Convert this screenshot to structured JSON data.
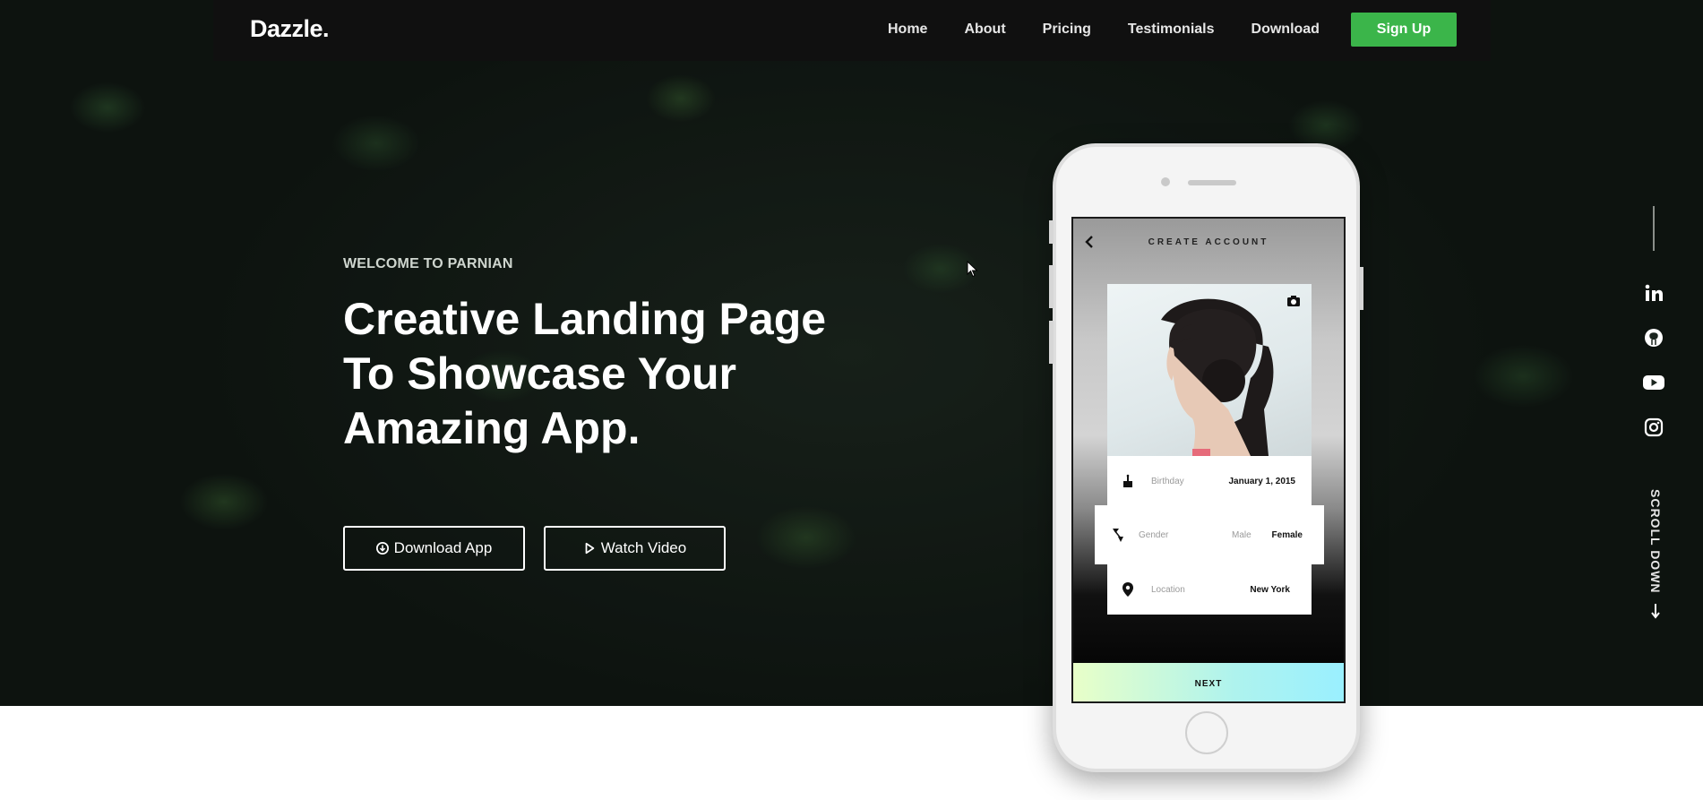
{
  "brand": "Dazzle.",
  "nav": {
    "links": [
      "Home",
      "About",
      "Pricing",
      "Testimonials",
      "Download"
    ],
    "signup_label": "Sign Up"
  },
  "hero": {
    "eyebrow": "WELCOME TO PARNIAN",
    "headline_line1": "Creative Landing Page",
    "headline_line2": "To Showcase Your",
    "headline_line3": "Amazing App.",
    "download_label": "Download App",
    "watch_label": "Watch Video"
  },
  "social": {
    "icons": [
      "linkedin-icon",
      "github-icon",
      "youtube-icon",
      "instagram-icon"
    ],
    "scroll_label": "SCROLL DOWN"
  },
  "phone": {
    "title": "CREATE ACCOUNT",
    "birthday_label": "Birthday",
    "birthday_value": "January 1, 2015",
    "gender_label": "Gender",
    "gender_option_male": "Male",
    "gender_option_female": "Female",
    "location_label": "Location",
    "location_value": "New York",
    "next_label": "NEXT"
  },
  "colors": {
    "accent": "#3bb54a",
    "navbar": "#101010"
  }
}
